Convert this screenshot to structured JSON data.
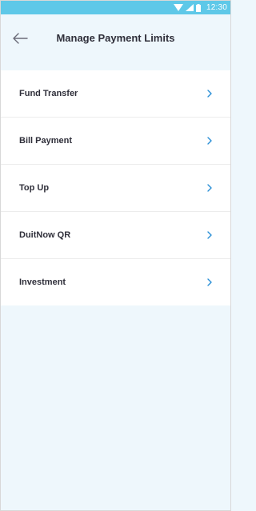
{
  "status_bar": {
    "time": "12:30",
    "icons": [
      "wifi-icon",
      "signal-icon",
      "battery-icon"
    ],
    "color": "#5ec8e8"
  },
  "header": {
    "title": "Manage Payment Limits",
    "back_icon": "arrow-left-icon"
  },
  "menu": {
    "items": [
      {
        "label": "Fund Transfer",
        "icon": "chevron-right-icon"
      },
      {
        "label": "Bill Payment",
        "icon": "chevron-right-icon"
      },
      {
        "label": "Top Up",
        "icon": "chevron-right-icon"
      },
      {
        "label": "DuitNow QR",
        "icon": "chevron-right-icon"
      },
      {
        "label": "Investment",
        "icon": "chevron-right-icon"
      }
    ]
  },
  "colors": {
    "background": "#eef7fc",
    "accent": "#2a8fd6",
    "text": "#2f2f3a"
  }
}
